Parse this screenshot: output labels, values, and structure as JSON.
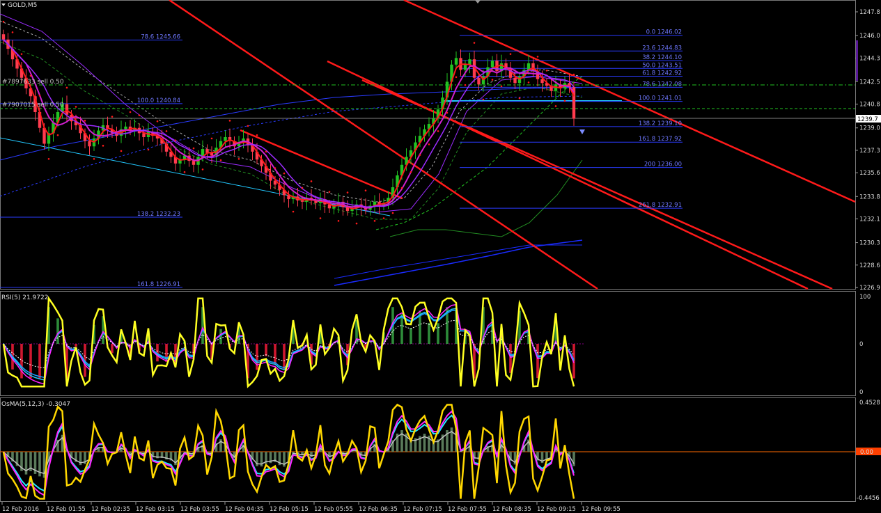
{
  "window": {
    "title": "GOLD,M5"
  },
  "price_panel": {
    "current_price": "1239.7",
    "y_ticks": [
      "1247.8",
      "1246.0",
      "1244.3",
      "1242.5",
      "1240.8",
      "1239.0",
      "1237.3",
      "1235.6",
      "1233.8",
      "1232.1",
      "1230.3",
      "1228.6",
      "1226.9"
    ],
    "orders": [
      "#7897633 sell 0.50",
      "#7907015 sell 0.50"
    ],
    "fib_right": [
      {
        "text": "0.0 1246.02"
      },
      {
        "text": "23.6 1244.83"
      },
      {
        "text": "38.2 1244.10"
      },
      {
        "text": "50.0 1243.51"
      },
      {
        "text": "61.8 1242.92"
      },
      {
        "text": "78.6 1242.08"
      },
      {
        "text": "100.0 1241.01"
      },
      {
        "text": "138.2 1239.10"
      },
      {
        "text": "161.8 1237.92"
      },
      {
        "text": "200 1236.00"
      },
      {
        "text": "261.8 1232.91"
      }
    ],
    "fib_left": [
      {
        "text": "78.6 1245.66"
      },
      {
        "text": "100.0 1240.84"
      },
      {
        "text": "138.2 1232.23"
      },
      {
        "text": "161.8 1226.91"
      }
    ]
  },
  "rsi_panel": {
    "title": "RSI(5) 21.9722",
    "y_ticks": [
      "100",
      "0",
      "0"
    ]
  },
  "osma_panel": {
    "title": "OsMA(5,12,3) -0.3047",
    "y_ticks": [
      "0.4528",
      "0.00",
      "-0.4456"
    ]
  },
  "time_axis": [
    "12 Feb 2016",
    "12 Feb 01:55",
    "12 Feb 02:35",
    "12 Feb 03:15",
    "12 Feb 03:55",
    "12 Feb 04:35",
    "12 Feb 05:15",
    "12 Feb 05:55",
    "12 Feb 06:35",
    "12 Feb 07:15",
    "12 Feb 07:55",
    "12 Feb 08:35",
    "12 Feb 09:15",
    "12 Feb 09:55"
  ],
  "colors": {
    "bull": "#22c322",
    "bear": "#ff3b4e",
    "trend": "#ff1a1a",
    "fib": "#3a46ff",
    "rsi": "#ffff22",
    "cyan": "#22c8ff",
    "magenta": "#ff22ff"
  },
  "chart_data": {
    "type": "candlestick",
    "symbol": "GOLD",
    "timeframe": "M5",
    "ylim": [
      1226.9,
      1248.3
    ],
    "last_price": 1239.7,
    "closes": [
      1245.7,
      1245.0,
      1244.2,
      1243.5,
      1242.8,
      1242.0,
      1241.4,
      1240.2,
      1239.0,
      1237.8,
      1238.6,
      1239.4,
      1240.2,
      1240.8,
      1240.0,
      1239.5,
      1239.2,
      1238.6,
      1238.0,
      1237.6,
      1238.2,
      1238.8,
      1239.2,
      1238.9,
      1238.6,
      1238.4,
      1238.9,
      1239.1,
      1238.8,
      1239.0,
      1238.6,
      1238.3,
      1238.7,
      1238.4,
      1238.2,
      1237.8,
      1237.2,
      1236.8,
      1236.3,
      1236.6,
      1236.9,
      1236.5,
      1236.2,
      1236.8,
      1237.4,
      1237.1,
      1236.9,
      1237.5,
      1238.0,
      1238.3,
      1238.0,
      1237.6,
      1237.9,
      1238.2,
      1237.7,
      1237.2,
      1236.6,
      1236.1,
      1235.6,
      1235.0,
      1234.7,
      1234.3,
      1233.9,
      1233.6,
      1233.8,
      1233.5,
      1233.4,
      1233.7,
      1233.5,
      1233.3,
      1233.6,
      1233.2,
      1232.9,
      1233.1,
      1233.4,
      1233.0,
      1232.7,
      1232.9,
      1233.2,
      1233.0,
      1232.8,
      1233.1,
      1233.4,
      1233.1,
      1233.3,
      1233.7,
      1234.5,
      1235.4,
      1236.2,
      1236.8,
      1237.3,
      1237.9,
      1238.4,
      1238.9,
      1239.3,
      1239.7,
      1240.4,
      1241.3,
      1242.5,
      1243.8,
      1244.3,
      1243.4,
      1243.8,
      1244.2,
      1242.8,
      1242.3,
      1242.9,
      1243.6,
      1244.1,
      1243.3,
      1243.9,
      1243.5,
      1242.8,
      1242.4,
      1242.9,
      1243.4,
      1243.9,
      1243.3,
      1242.7,
      1242.4,
      1242.2,
      1241.8,
      1242.3,
      1242.0,
      1242.4,
      1242.1,
      1239.7
    ]
  }
}
